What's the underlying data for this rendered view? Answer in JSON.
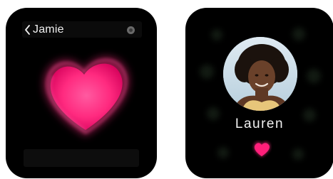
{
  "left_screen": {
    "back_label": "Jamie",
    "icons": {
      "back": "chevron-left-icon",
      "heart": "heart-icon",
      "indicator": "dot-indicator-icon"
    },
    "accent_color": "#ff1f7a"
  },
  "right_screen": {
    "contact_name": "Lauren",
    "icons": {
      "avatar": "contact-photo",
      "heart": "heart-icon"
    },
    "accent_color": "#ff1f7a"
  }
}
